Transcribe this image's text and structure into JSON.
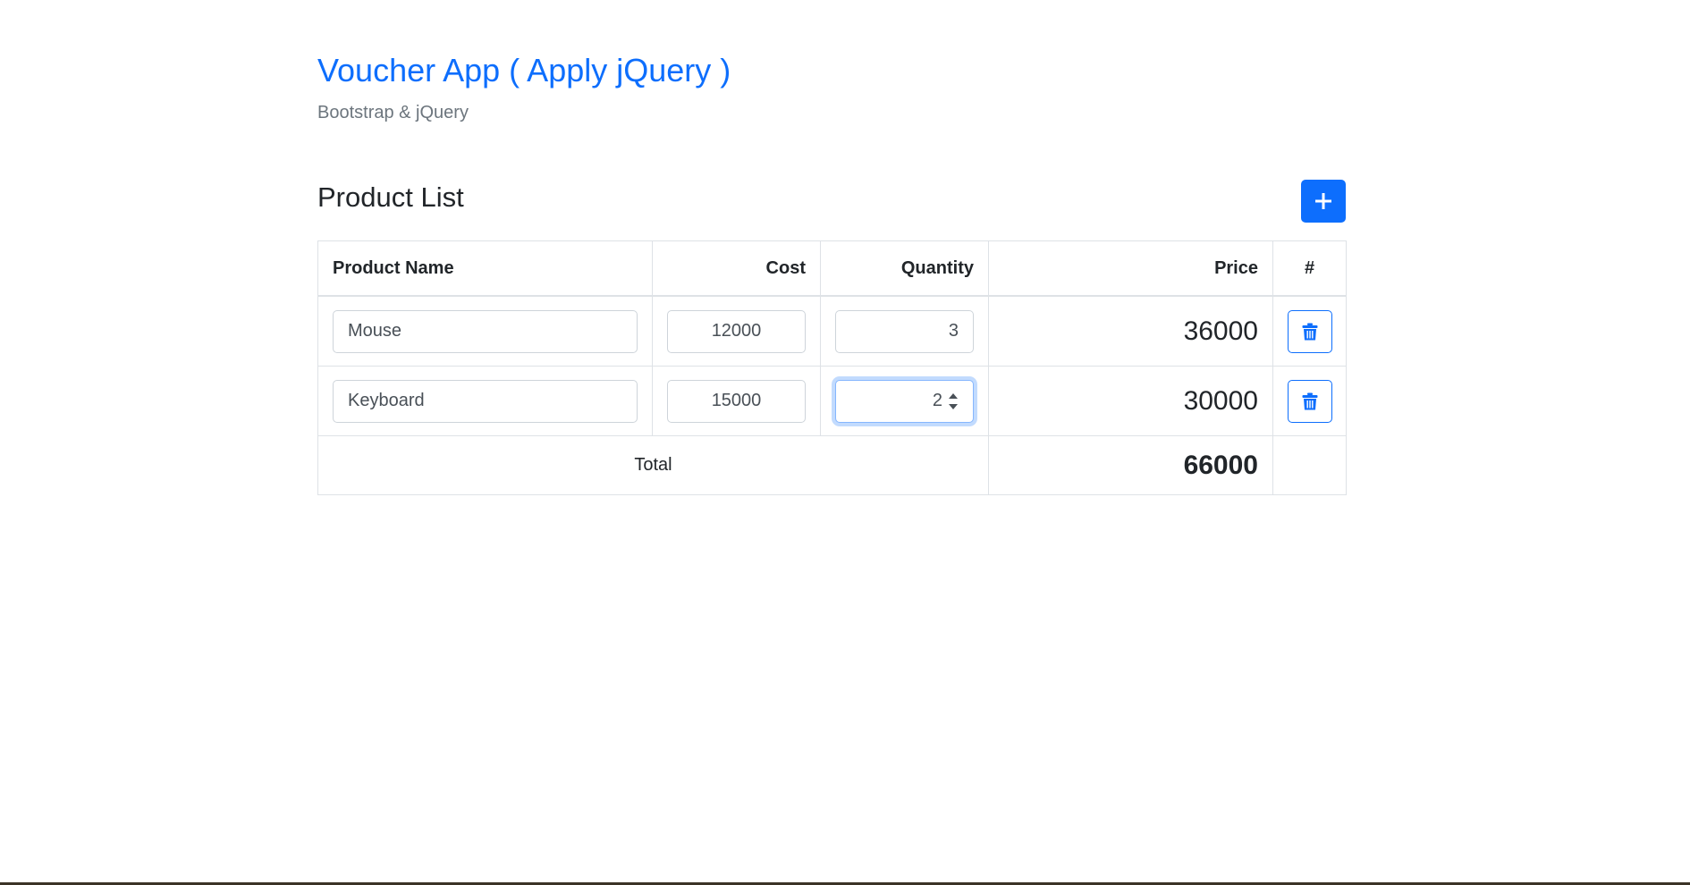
{
  "header": {
    "title": "Voucher App ( Apply jQuery )",
    "subtitle": "Bootstrap & jQuery"
  },
  "section": {
    "title": "Product List",
    "add_icon": "plus-icon"
  },
  "table": {
    "columns": {
      "name": "Product Name",
      "cost": "Cost",
      "quantity": "Quantity",
      "price": "Price",
      "action": "#"
    },
    "rows": [
      {
        "name": "Mouse",
        "cost": "12000",
        "quantity": "3",
        "price": "36000",
        "delete_icon": "trash-icon"
      },
      {
        "name": "Keyboard",
        "cost": "15000",
        "quantity": "2",
        "price": "30000",
        "delete_icon": "trash-icon"
      }
    ],
    "footer": {
      "label": "Total",
      "total": "66000"
    }
  },
  "colors": {
    "primary": "#0d6efd",
    "muted": "#6c757d",
    "border": "#dee2e6"
  }
}
